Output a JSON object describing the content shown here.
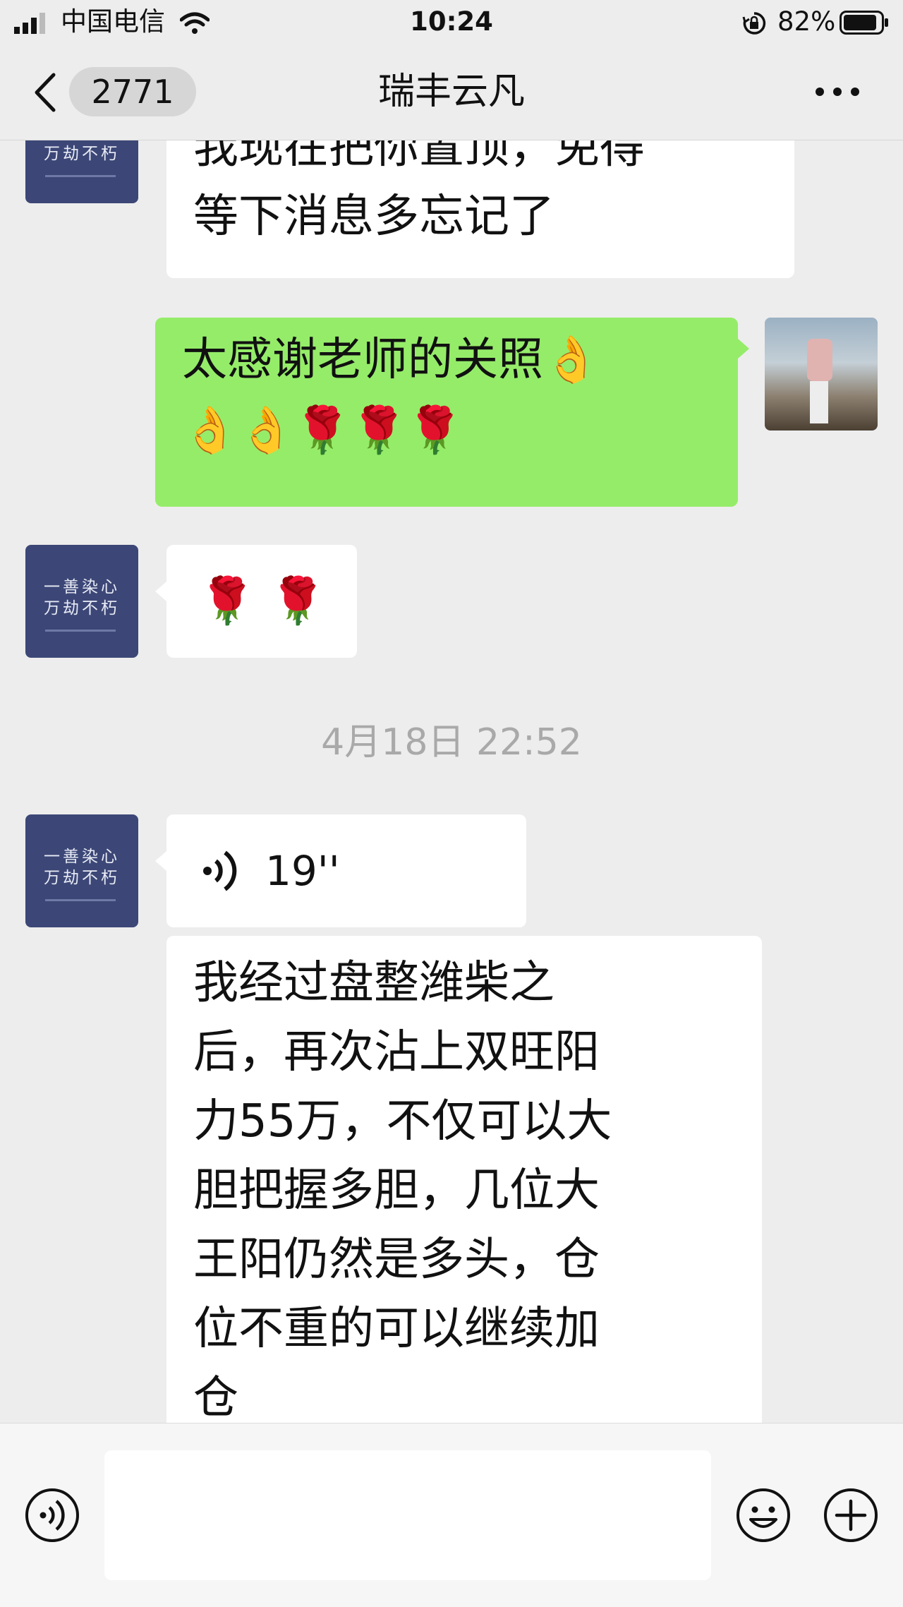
{
  "status_bar": {
    "carrier": "中国电信",
    "time": "10:24",
    "battery_percent": "82%"
  },
  "nav": {
    "unread_count": "2771",
    "title": "瑞丰云凡"
  },
  "avatar_text": {
    "line1": "一善染心",
    "line2": "万劫不朽"
  },
  "messages": [
    {
      "side": "left",
      "type": "text",
      "text": "我现在把你置顶，免得\n等下消息多忘记了"
    },
    {
      "side": "right",
      "type": "text",
      "text": "太感谢老师的关照👌\n👌👌🌹🌹🌹"
    },
    {
      "side": "left",
      "type": "emoji",
      "text": "🌹 🌹"
    },
    {
      "side": "left",
      "type": "voice",
      "duration": "19''"
    },
    {
      "side": "left",
      "type": "text",
      "text": "我经过盘整潍柴之\n后，再次沾上双旺阳\n力55万，不仅可以大\n胆把握多胆，几位大\n王阳仍然是多头，仓\n位不重的可以继续加\n仓"
    }
  ],
  "timestamp": "4月18日 22:52"
}
